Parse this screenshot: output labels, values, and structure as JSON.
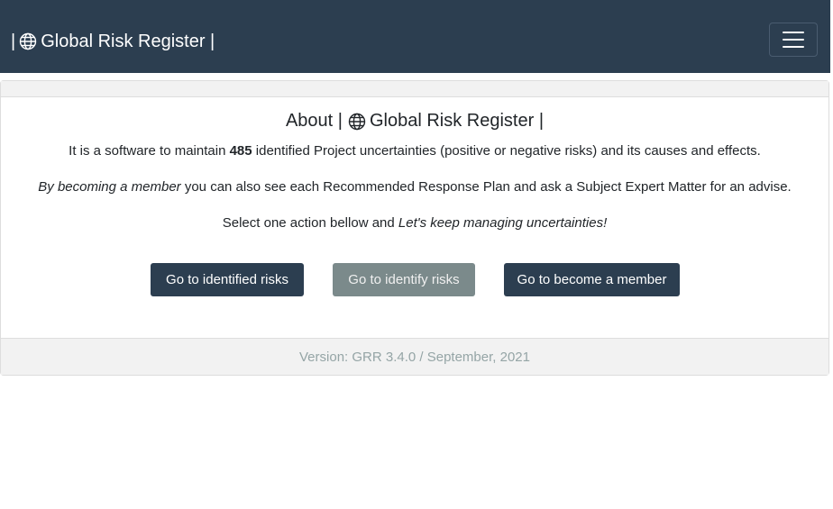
{
  "navbar": {
    "brand_prefix": "|",
    "brand_name": "Global Risk Register |",
    "brand_icon": "globe-icon",
    "menu_icon": "hamburger-menu-icon",
    "background": "#2c3e50"
  },
  "about": {
    "title_prefix": "About |",
    "title_name": "Global Risk Register |",
    "line1_before": "It is a software to maintain ",
    "risk_count": "485",
    "line1_after": " identified Project uncertainties (positive or negative risks) and its causes and effects.",
    "line2_emphasis": "By becoming a member",
    "line2_rest": " you can also see each Recommended Response Plan and ask a Subject Expert Matter for an advise.",
    "line3_before": "Select one action bellow and ",
    "line3_emphasis": "Let's keep managing uncertainties!"
  },
  "actions": {
    "identified_risks": "Go to identified risks",
    "identify_risks": "Go to identify risks",
    "become_member": "Go to become a member"
  },
  "footer": {
    "version": "Version: GRR 3.4.0 / September, 2021"
  },
  "colors": {
    "primary": "#2c3e50",
    "secondary": "#7b8a8b",
    "muted_text": "#95a5a6"
  }
}
